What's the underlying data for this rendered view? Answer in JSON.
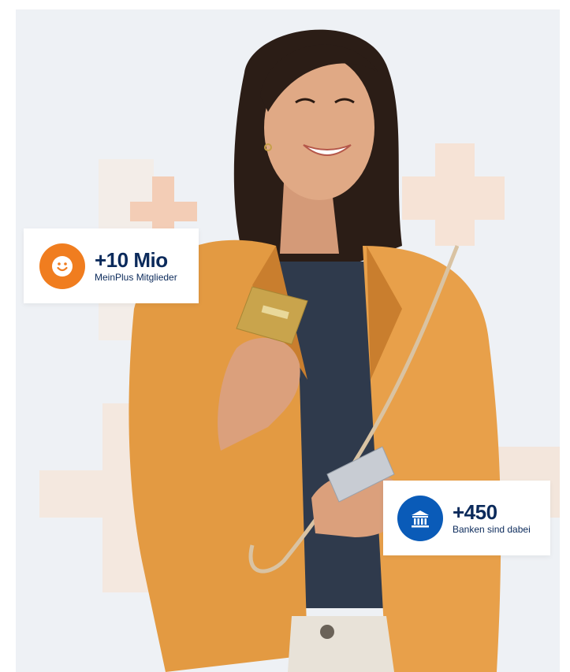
{
  "stats": [
    {
      "value": "+10 Mio",
      "label": "MeinPlus Mitglieder",
      "icon": "smiley-icon",
      "color": "#f07d1f"
    },
    {
      "value": "+450",
      "label": "Banken sind dabei",
      "icon": "bank-icon",
      "color": "#0a5bb8"
    }
  ],
  "colors": {
    "background": "#eef1f5",
    "accent_cross": "#f6d2bd",
    "text": "#0b2a5b"
  }
}
